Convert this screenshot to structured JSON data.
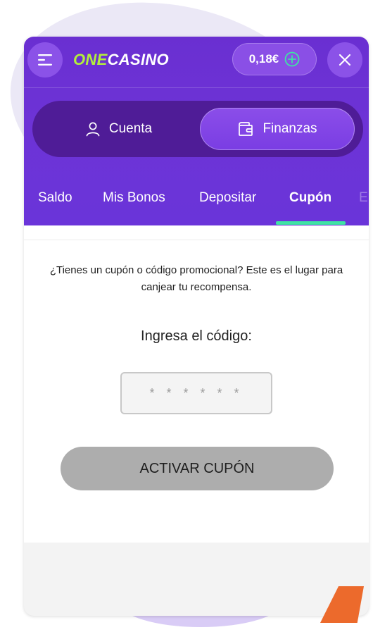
{
  "header": {
    "logo_prefix": "O",
    "logo_highlight": "NE",
    "logo_rest": "CASINO",
    "balance": "0,18€"
  },
  "segment": {
    "cuenta_label": "Cuenta",
    "finanzas_label": "Finanzas",
    "active": "Finanzas"
  },
  "tabs": [
    {
      "label": "Saldo"
    },
    {
      "label": "Mis Bonos"
    },
    {
      "label": "Depositar"
    },
    {
      "label": "Cupón",
      "active": true
    },
    {
      "label": "E"
    }
  ],
  "content": {
    "description": "¿Tienes un cupón o código promocional? Este es el lugar para canjear tu recompensa.",
    "code_label": "Ingresa el código:",
    "code_placeholder": "* * * * * *",
    "activate_label": "ACTIVAR CUPÓN"
  },
  "colors": {
    "brand_purple": "#6d33d6",
    "accent_green": "#3ee4a4",
    "logo_green": "#b3ef3b",
    "button_disabled": "#adadad",
    "orange_decoration": "#ec6a2c"
  },
  "icons": {
    "menu": "menu-icon",
    "add": "plus-circle-icon",
    "close": "close-icon",
    "cuenta": "user-icon",
    "finanzas": "wallet-icon"
  }
}
